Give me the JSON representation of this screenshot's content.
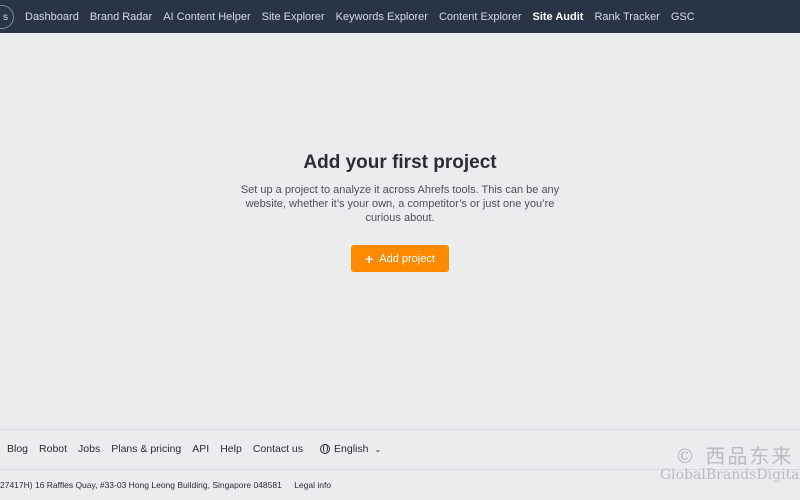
{
  "nav": {
    "logo_fragment": "s",
    "items": [
      {
        "label": "Dashboard"
      },
      {
        "label": "Brand Radar"
      },
      {
        "label": "AI Content Helper"
      },
      {
        "label": "Site Explorer"
      },
      {
        "label": "Keywords Explorer"
      },
      {
        "label": "Content Explorer"
      },
      {
        "label": "Site Audit",
        "active": true
      },
      {
        "label": "Rank Tracker"
      },
      {
        "label": "GSC"
      }
    ]
  },
  "empty_state": {
    "title": "Add your first project",
    "description": "Set up a project to analyze it across Ahrefs tools. This can be any website, whether it’s your own, a competitor’s or just one you’re curious about.",
    "button_label": "Add project",
    "button_icon": "plus-icon"
  },
  "footer": {
    "links": [
      "Blog",
      "Robot",
      "Jobs",
      "Plans & pricing",
      "API",
      "Help",
      "Contact us"
    ],
    "language": "English",
    "address": "27417H) 16 Raffles Quay, #33-03 Hong Leong Building, Singapore 048581",
    "legal": "Legal info"
  },
  "watermark": {
    "line1": "© 西品东来",
    "line2": "GlobalBrandsDigital"
  },
  "colors": {
    "nav_bg": "#2a3447",
    "page_bg": "#ebecee",
    "accent": "#ff8a00"
  }
}
